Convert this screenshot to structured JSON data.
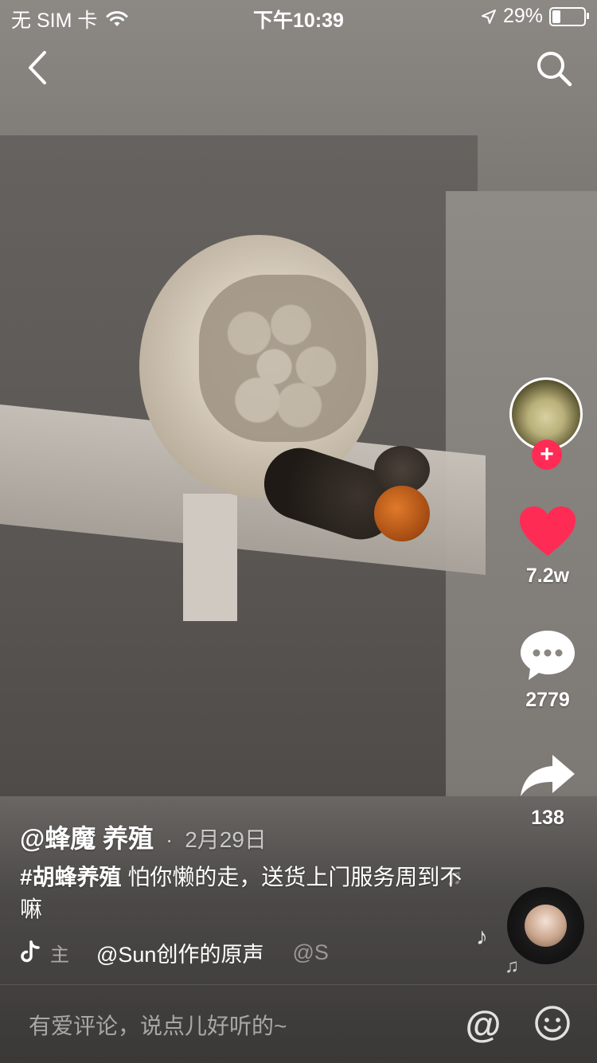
{
  "status_bar": {
    "carrier": "无 SIM 卡",
    "time": "下午10:39",
    "battery": "29%",
    "battery_level": 0.29
  },
  "nav": {
    "back_icon": "chevron-left-icon",
    "search_icon": "search-icon"
  },
  "actions": {
    "follow_symbol": "+",
    "likes": "7.2w",
    "comments": "2779",
    "shares": "138"
  },
  "post": {
    "author": "@蜂魔 养殖",
    "separator": "·",
    "date": "2月29日",
    "hashtag": "#胡蜂养殖",
    "caption_text": "怕你懒的走，送货上门服务周到不嘛"
  },
  "music": {
    "faded_prefix": "主",
    "title": "@Sun创作的原声",
    "faded_suffix": "@S"
  },
  "comment_bar": {
    "placeholder": "有爱评论，说点儿好听的~",
    "at_symbol": "@"
  },
  "colors": {
    "like_red": "#fe2c55",
    "follow_red": "#fe2c55"
  }
}
